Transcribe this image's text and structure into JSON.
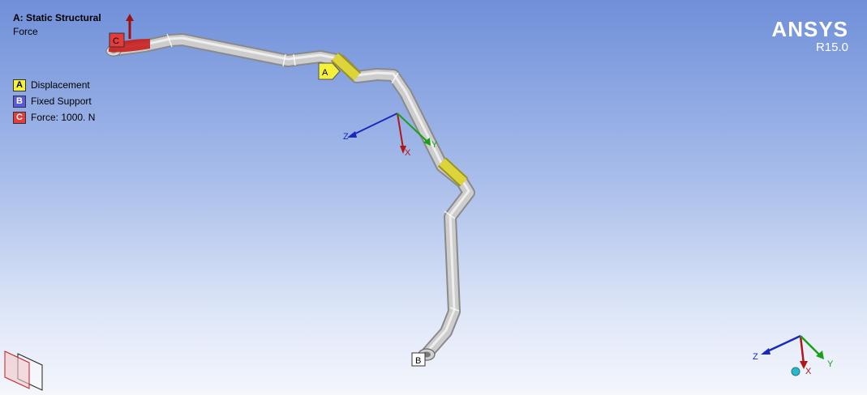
{
  "header": {
    "title": "A: Static Structural",
    "subtitle": "Force"
  },
  "legend": [
    {
      "tag": "A",
      "label": "Displacement",
      "color": "#f5f03a"
    },
    {
      "tag": "B",
      "label": "Fixed Support",
      "color": "#5a5adf"
    },
    {
      "tag": "C",
      "label": "Force: 1000. N",
      "color": "#e43b3b"
    }
  ],
  "brand": {
    "name": "ANSYS",
    "version": "R15.0"
  },
  "model_tags": {
    "a": "A",
    "b": "B",
    "c": "C"
  },
  "triad": {
    "x": "X",
    "y": "Y",
    "z": "Z"
  },
  "colors": {
    "pipe": "#c8c8c8",
    "displacement": "#d8d02a",
    "force": "#c81e1e",
    "x_axis": "#b01818",
    "y_axis": "#18a018",
    "z_axis": "#1a2ab8"
  }
}
